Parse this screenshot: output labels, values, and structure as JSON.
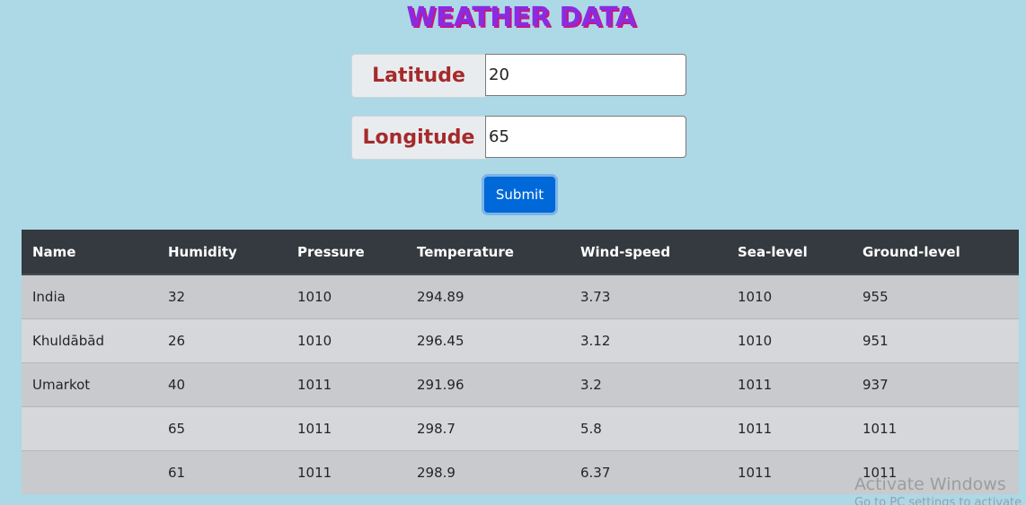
{
  "page_title": "WEATHER DATA",
  "form": {
    "latitude_label": "Latitude",
    "latitude_value": "20",
    "longitude_label": "Longitude",
    "longitude_value": "65",
    "submit_label": "Submit"
  },
  "table": {
    "headers": [
      "Name",
      "Humidity",
      "Pressure",
      "Temperature",
      "Wind-speed",
      "Sea-level",
      "Ground-level"
    ],
    "rows": [
      [
        "India",
        "32",
        "1010",
        "294.89",
        "3.73",
        "1010",
        "955"
      ],
      [
        "Khuldābād",
        "26",
        "1010",
        "296.45",
        "3.12",
        "1010",
        "951"
      ],
      [
        "Umarkot",
        "40",
        "1011",
        "291.96",
        "3.2",
        "1011",
        "937"
      ],
      [
        "",
        "65",
        "1011",
        "298.7",
        "5.8",
        "1011",
        "1011"
      ],
      [
        "",
        "61",
        "1011",
        "298.9",
        "6.37",
        "1011",
        "1011"
      ]
    ]
  },
  "watermark": {
    "line1": "Activate Windows",
    "line2": "Go to PC settings to activate"
  },
  "colors": {
    "background": "#add8e6",
    "title": "#8a2be2",
    "label_text": "#a52a2a",
    "button": "#0069d9",
    "table_header": "#343a40"
  }
}
